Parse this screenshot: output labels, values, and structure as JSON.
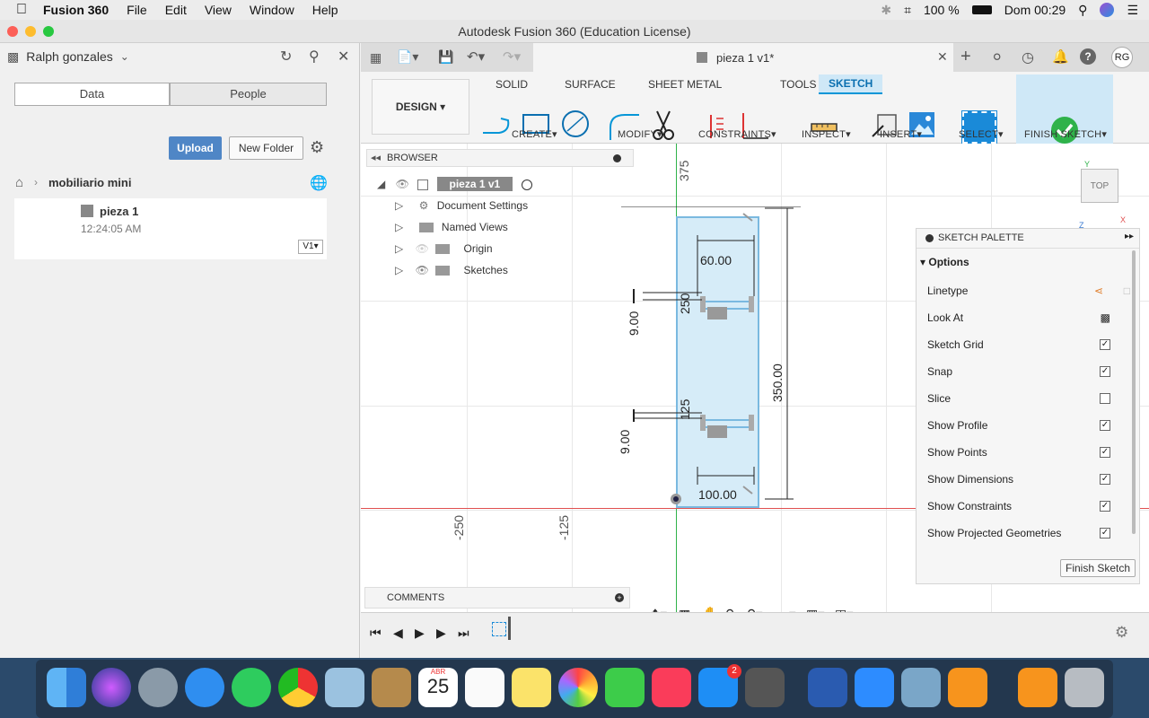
{
  "menubar": {
    "app_name": "Fusion 360",
    "items": [
      "File",
      "Edit",
      "View",
      "Window",
      "Help"
    ],
    "battery": "100 %",
    "clock": "Dom 00:29"
  },
  "window": {
    "title": "Autodesk Fusion 360 (Education License)"
  },
  "data_panel": {
    "user": "Ralph gonzales",
    "tabs": [
      "Data",
      "People"
    ],
    "upload_label": "Upload",
    "new_folder_label": "New Folder",
    "breadcrumb": "mobiliario mini",
    "file": {
      "name": "pieza 1",
      "time": "12:24:05 AM",
      "version": "V1"
    }
  },
  "document": {
    "tab_title": "pieza 1 v1*"
  },
  "toolbar": {
    "design_label": "DESIGN",
    "workspace_tabs": [
      "SOLID",
      "SURFACE",
      "SHEET METAL",
      "TOOLS",
      "SKETCH"
    ],
    "groups": [
      "CREATE",
      "MODIFY",
      "CONSTRAINTS",
      "INSPECT",
      "INSERT",
      "SELECT",
      "FINISH SKETCH"
    ],
    "user_initials": "RG"
  },
  "browser": {
    "title": "BROWSER",
    "root": "pieza 1 v1",
    "items": [
      "Document Settings",
      "Named Views",
      "Origin",
      "Sketches"
    ]
  },
  "canvas": {
    "viewcube": "TOP",
    "axis_labels": [
      "375",
      "-250",
      "-125"
    ],
    "dimensions": [
      "60.00",
      "250",
      "9.00",
      "125",
      "9.00",
      "350.00",
      "100.00"
    ]
  },
  "sketch_palette": {
    "title": "SKETCH PALETTE",
    "section": "Options",
    "options": [
      {
        "label": "Linetype",
        "kind": "icon"
      },
      {
        "label": "Look At",
        "kind": "icon"
      },
      {
        "label": "Sketch Grid",
        "checked": true
      },
      {
        "label": "Snap",
        "checked": true
      },
      {
        "label": "Slice",
        "checked": false
      },
      {
        "label": "Show Profile",
        "checked": true
      },
      {
        "label": "Show Points",
        "checked": true
      },
      {
        "label": "Show Dimensions",
        "checked": true
      },
      {
        "label": "Show Constraints",
        "checked": true
      },
      {
        "label": "Show Projected Geometries",
        "checked": true
      }
    ],
    "finish_label": "Finish Sketch"
  },
  "comments": {
    "title": "COMMENTS"
  },
  "dock": {
    "calendar_month": "ABR",
    "calendar_day": "25",
    "badge": "2"
  },
  "colors": {
    "accent": "#0696d7",
    "selection_fill": "#d6ecf8",
    "finish_green": "#2fb24a"
  }
}
